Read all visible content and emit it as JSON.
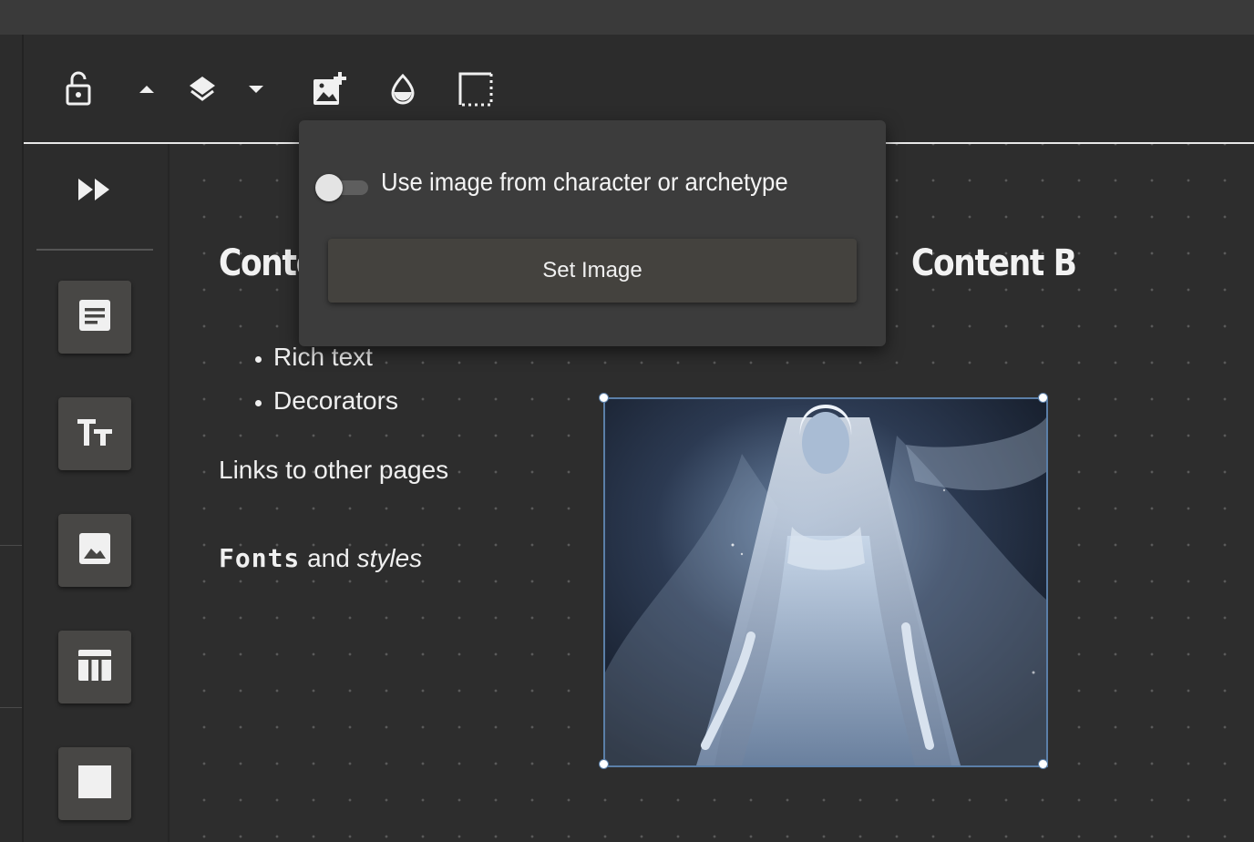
{
  "toolbar": {
    "icons": [
      "lock-open-icon",
      "arrow-up-icon",
      "layers-icon",
      "arrow-down-icon",
      "add-image-icon",
      "opacity-icon",
      "border-icon"
    ]
  },
  "sidebar": {
    "icons": [
      "fast-forward-icon",
      "text-box-icon",
      "text-size-icon",
      "image-icon",
      "table-icon",
      "square-icon"
    ]
  },
  "canvas": {
    "heading_a": "Content A",
    "heading_b": "Content B",
    "bullets": [
      "Rich text",
      "Decorators"
    ],
    "links_text": "Links to other pages",
    "fonts_word": "Fonts",
    "and_word": "and",
    "styles_word": "styles"
  },
  "popup": {
    "toggle_label": "Use image from character or archetype",
    "toggle_on": false,
    "set_image_label": "Set Image"
  },
  "colors": {
    "accent_border": "#5b7fa8",
    "background": "#2a2a2a",
    "button_bg": "#484745"
  }
}
